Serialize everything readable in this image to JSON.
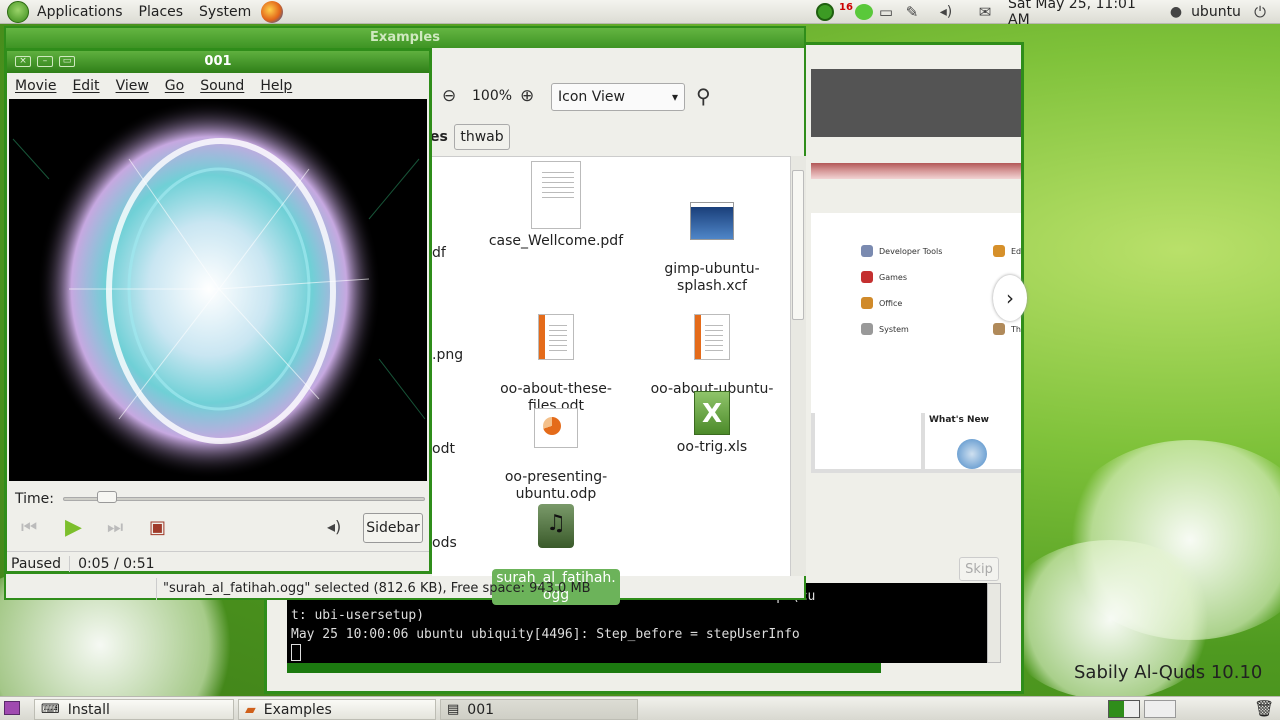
{
  "top_panel": {
    "menus": [
      "Applications",
      "Places",
      "System"
    ],
    "mail_count": "16",
    "clock": "Sat May 25, 11:01 AM",
    "user": "ubuntu"
  },
  "installer": {
    "categories": [
      "Developer Tools",
      "Games",
      "Office",
      "System"
    ],
    "categories_right": [
      "Ed",
      "Th"
    ],
    "whats_new": "What's New",
    "skip_label": "Skip",
    "terminal_lines": [
      "                                                  ubi-usersetup (cu",
      "t: ubi-usersetup)",
      "May 25 10:00:06 ubuntu ubiquity[4496]: Step_before = stepUserInfo"
    ]
  },
  "nautilus": {
    "title": "Examples",
    "zoom": "100%",
    "view_mode": "Icon View",
    "breadcrumb_prev": "es",
    "breadcrumb_current": "thwab",
    "files": [
      {
        "name": "case_Wellcome.pdf",
        "icon": "pdf-icon"
      },
      {
        "name": "gimp-ubuntu-\nsplash.xcf",
        "icon": "image-icon"
      },
      {
        "name": "oo-about-these-\nfiles.odt",
        "icon": "document-icon"
      },
      {
        "name": "oo-about-ubuntu-ru.\nrtf",
        "icon": "document-icon"
      },
      {
        "name": "oo-presenting-\nubuntu.odp",
        "icon": "presentation-icon"
      },
      {
        "name": "oo-trig.xls",
        "icon": "spreadsheet-icon"
      },
      {
        "name": "surah_al_fatihah.\nogg",
        "icon": "audio-icon",
        "selected": true
      }
    ],
    "partial_labels": [
      "df",
      ".png",
      "odt",
      "ods"
    ],
    "status": "\"surah_al_fatihah.ogg\" selected (812.6 KB), Free space: 943.0 MB"
  },
  "totem": {
    "title": "001",
    "menu": [
      "Movie",
      "Edit",
      "View",
      "Go",
      "Sound",
      "Help"
    ],
    "time_label": "Time:",
    "sidebar_label": "Sidebar",
    "state": "Paused",
    "time": "0:05 / 0:51",
    "progress_fraction": 0.098
  },
  "taskbar": {
    "items": [
      "Install",
      "Examples",
      "001"
    ]
  },
  "desktop_label": "Sabily Al-Quds 10.10",
  "colors": {
    "accent": "#2f8d1a",
    "selection": "#6cb35a"
  }
}
